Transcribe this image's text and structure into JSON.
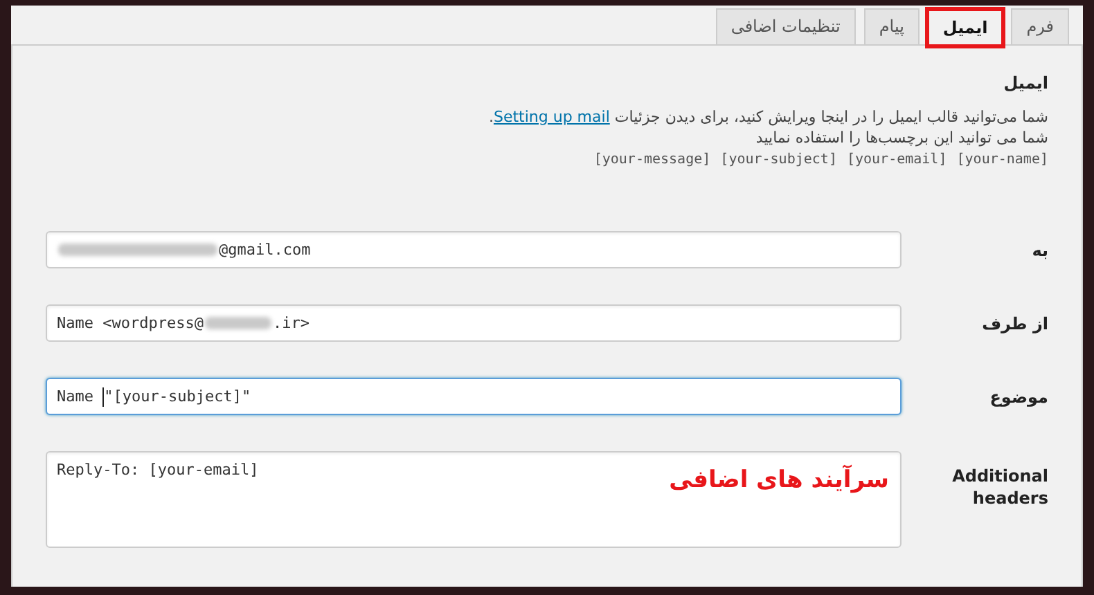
{
  "tabs": [
    {
      "label": "فرم",
      "selected": false,
      "highlighted": false
    },
    {
      "label": "ایمیل",
      "selected": true,
      "highlighted": true
    },
    {
      "label": "پیام",
      "selected": false,
      "highlighted": false
    },
    {
      "label": "تنظیمات اضافی",
      "selected": false,
      "highlighted": false
    }
  ],
  "section_title": "ایمیل",
  "intro": {
    "text": "شما می‌توانید قالب ایمیل را در اینجا ویرایش کنید، برای دیدن جزئیات",
    "link": "Setting up mail",
    "end": "."
  },
  "tags_hint": "شما می توانید این برچسب‌ها را استفاده نمایید",
  "mail_tags": [
    "[your-name]",
    "[your-email]",
    "[your-subject]",
    "[your-message]"
  ],
  "fields": [
    {
      "label": "به",
      "kind": "input",
      "redacted": true,
      "value": "@gmail.com",
      "focused": false
    },
    {
      "label": "از طرف",
      "kind": "input",
      "redacted": true,
      "before": "Name <wordpress@",
      "value": ".ir>",
      "focused": false
    },
    {
      "label": "موضوع",
      "kind": "input",
      "redacted": false,
      "before": "Name ",
      "value": "\"[your-subject]\"",
      "focused": true
    },
    {
      "label": "Additional headers",
      "kind": "textarea",
      "value": "Reply-To: [your-email]",
      "focused": false,
      "annotation": "سرآیند های اضافی"
    }
  ]
}
